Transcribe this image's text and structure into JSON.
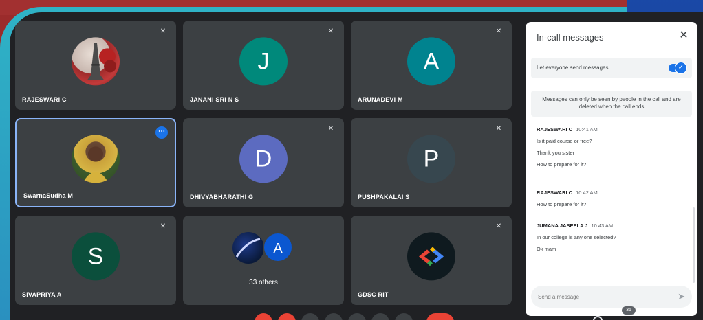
{
  "tiles": [
    {
      "name": "RAJESWARI C",
      "avatar_type": "photo",
      "muted": true
    },
    {
      "name": "JANANI SRI N S",
      "initial": "J",
      "color": "#00897b",
      "muted": true
    },
    {
      "name": "ARUNADEVI M",
      "initial": "A",
      "color": "#00838f",
      "muted": true
    },
    {
      "name": "SwarnaSudha M",
      "avatar_type": "photo",
      "active": true
    },
    {
      "name": "DHIVYABHARATHI G",
      "initial": "D",
      "color": "#5c6bc0",
      "muted": true
    },
    {
      "name": "PUSHPAKALAI S",
      "initial": "P",
      "color": "#37474f",
      "muted": true
    },
    {
      "name": "SIVAPRIYA A",
      "initial": "S",
      "color": "#0b4f3c",
      "muted": true
    },
    {
      "name": "",
      "initial": "A",
      "color": "#0b57d0",
      "others_label": "33 others"
    },
    {
      "name": "GDSC RIT",
      "avatar_type": "logo",
      "muted": true
    }
  ],
  "panel": {
    "title": "In-call messages",
    "toggle_label": "Let everyone send messages",
    "toggle_on": true,
    "notice": "Messages can only be seen by people in the call and are deleted when the call ends",
    "messages": [
      {
        "sender": "RAJESWARI C",
        "time": "10:41 AM",
        "lines": [
          "Is it paid course or free?",
          "Thank you sister",
          "How to prepare for it?"
        ]
      },
      {
        "sender": "RAJESWARI C",
        "time": "10:42 AM",
        "lines": [
          "How to prepare for it?"
        ]
      },
      {
        "sender": "JUMANA JASEELA J",
        "time": "10:43 AM",
        "lines": [
          "In our college is any one selected?",
          "Ok mam"
        ]
      }
    ],
    "composer_placeholder": "Send a message"
  },
  "participants_count": "35",
  "colors": {
    "bar_red": "#ea4335",
    "panel_bg": "#ffffff",
    "tile_bg": "#3c4043",
    "accent": "#1a73e8"
  }
}
